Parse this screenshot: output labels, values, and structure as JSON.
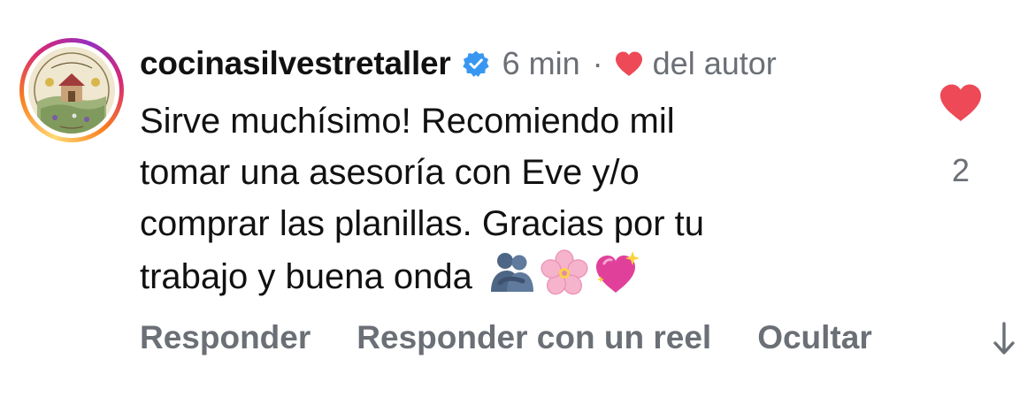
{
  "comment": {
    "username": "cocinasilvestretaller",
    "verified_icon": "verified-badge-icon",
    "time": "6 min",
    "separator": "·",
    "author_like_label": "del autor",
    "text_lines": [
      "Sirve muchísimo! Recomiendo mil",
      "tomar una asesoría con Eve y/o",
      "comprar las planillas. Gracias por tu",
      "trabajo y buena onda"
    ],
    "emojis": [
      "people-hugging-emoji",
      "cherry-blossom-emoji",
      "sparkling-heart-emoji"
    ],
    "like_count": "2",
    "liked": true
  },
  "actions": {
    "reply": "Responder",
    "reply_reel": "Responder con un reel",
    "hide": "Ocultar"
  },
  "colors": {
    "heart": "#ed4956",
    "verified": "#3897f0",
    "muted": "#6b6f76",
    "text": "#111111"
  }
}
